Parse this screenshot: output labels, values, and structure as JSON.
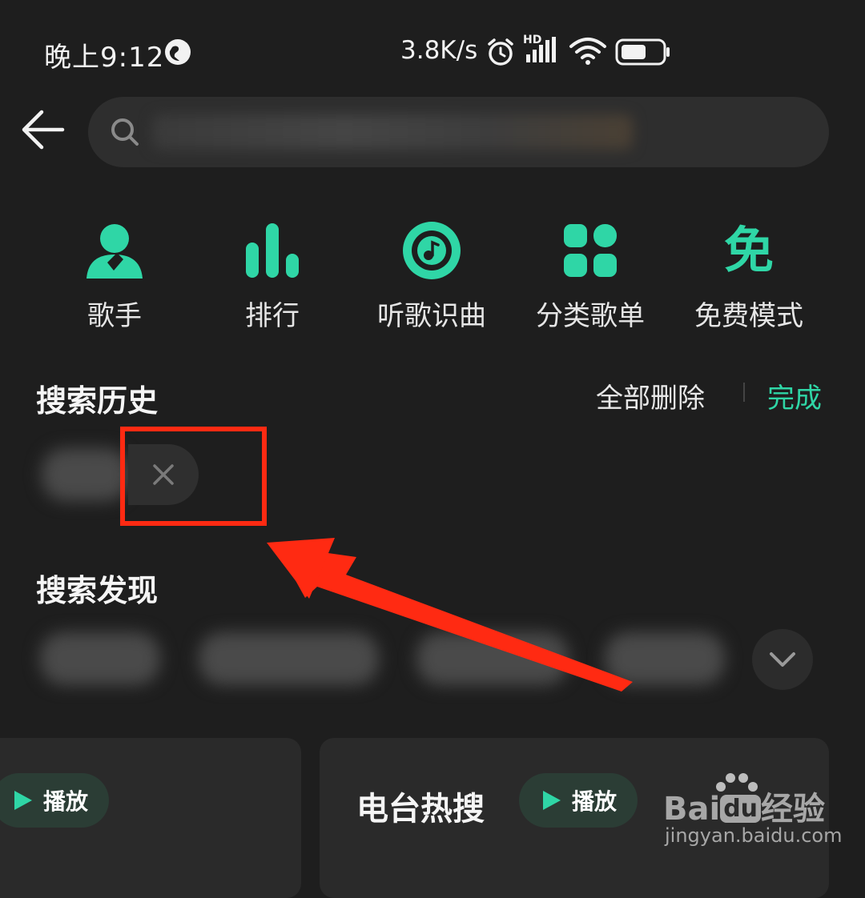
{
  "status_bar": {
    "time": "晚上9:12",
    "net_speed": "3.8K/s",
    "signal_tag": "HD"
  },
  "search": {
    "back_icon": "arrow-left-icon",
    "search_icon": "search-icon"
  },
  "categories": [
    {
      "label": "歌手",
      "icon": "singer-icon"
    },
    {
      "label": "排行",
      "icon": "chart-bars-icon"
    },
    {
      "label": "听歌识曲",
      "icon": "music-disc-icon"
    },
    {
      "label": "分类歌单",
      "icon": "category-grid-icon"
    },
    {
      "label": "免费模式",
      "icon": "free-mode-icon",
      "glyph": "免"
    }
  ],
  "history": {
    "title": "搜索历史",
    "delete_all": "全部删除",
    "done": "完成"
  },
  "discover": {
    "title": "搜索发现"
  },
  "cards": [
    {
      "play_label": "播放"
    },
    {
      "title": "电台热搜",
      "play_label": "播放"
    }
  ],
  "watermark": {
    "brand_bai": "Bai",
    "brand_du": "du",
    "brand_cn": "经验",
    "url": "jingyan.baidu.com"
  },
  "colors": {
    "accent": "#2fd6a6",
    "annotation": "#ff2a12",
    "background": "#1e1e1e"
  }
}
